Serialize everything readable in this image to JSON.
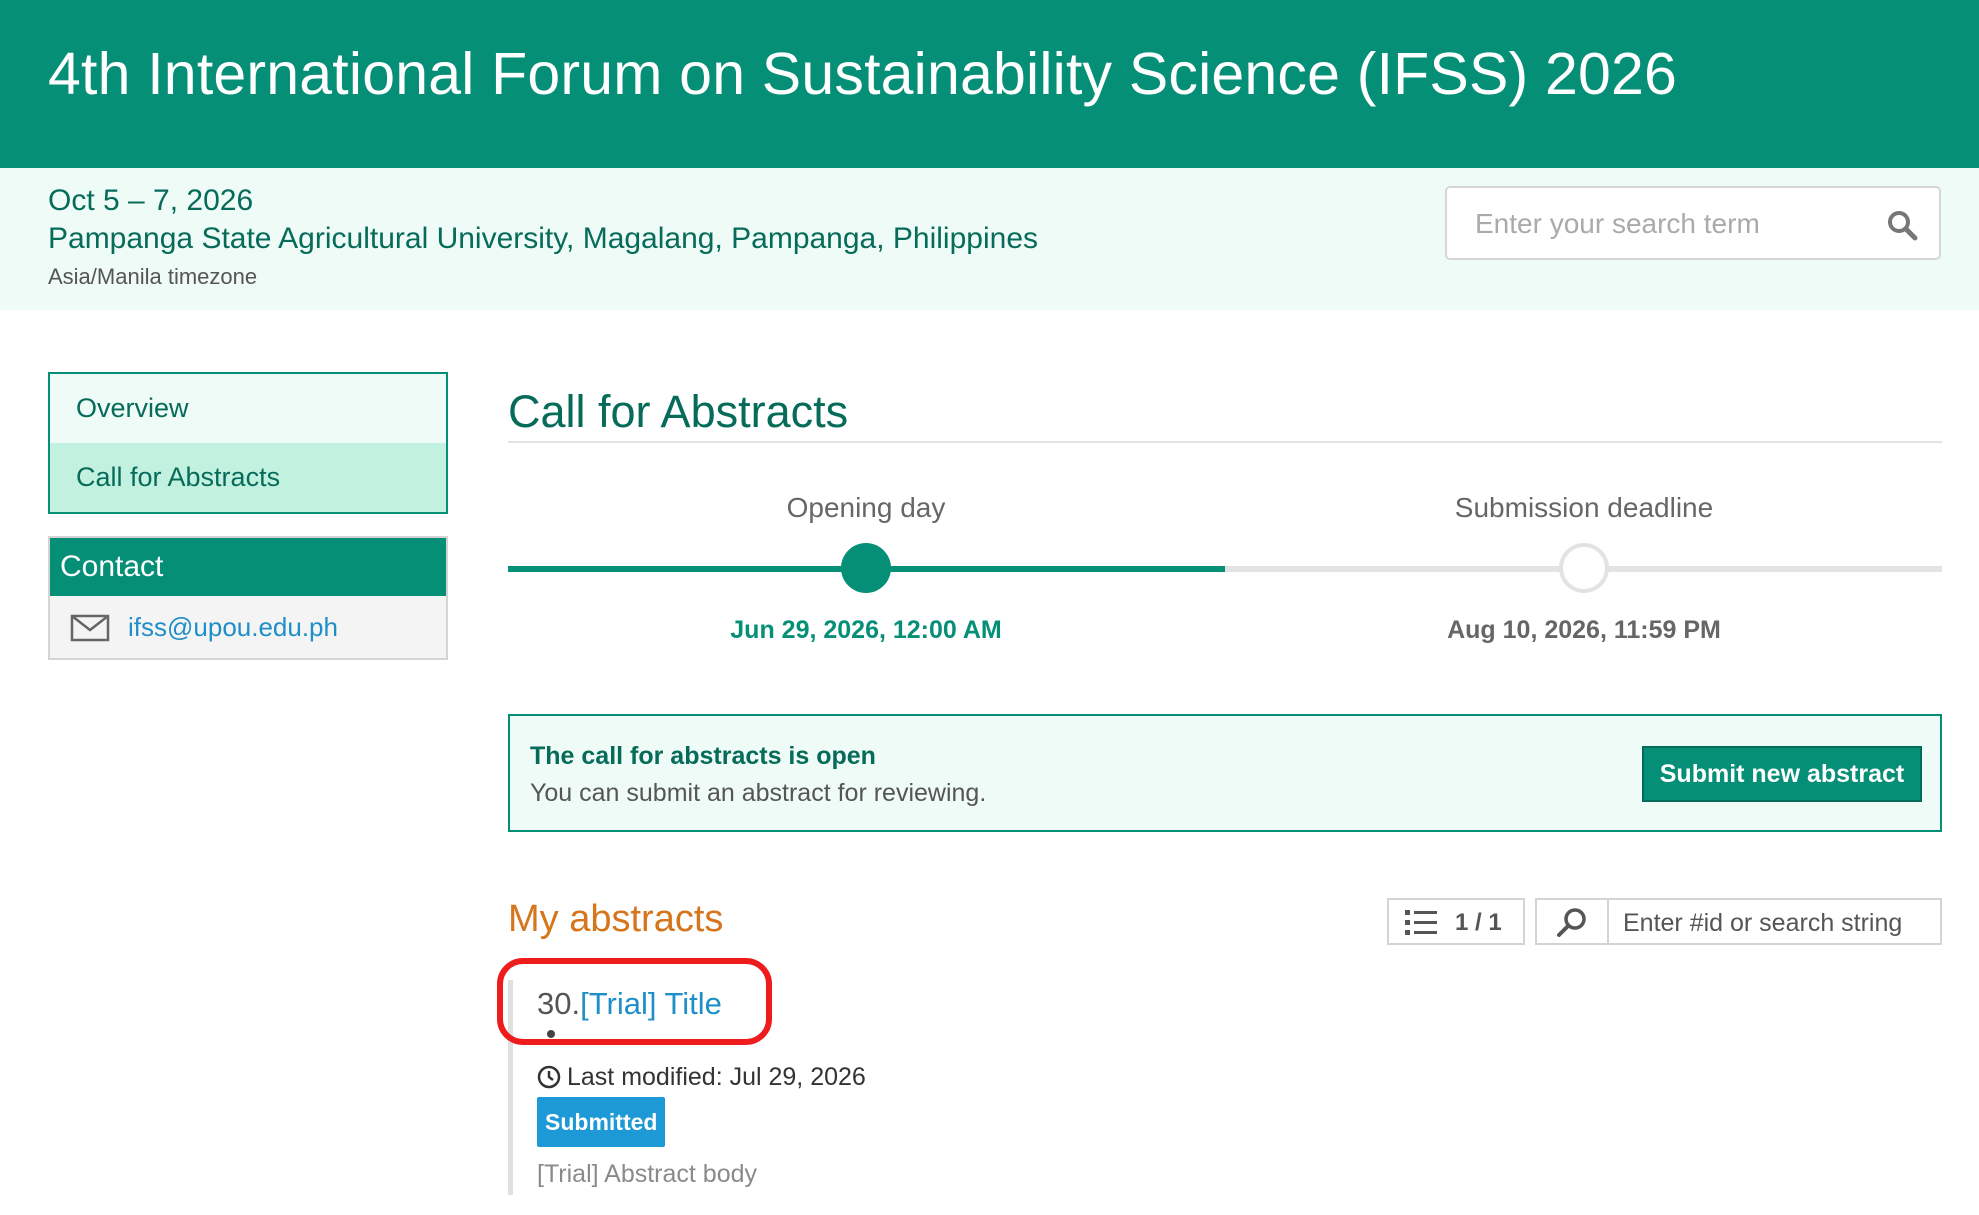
{
  "header": {
    "title": "4th International Forum on Sustainability Science (IFSS) 2026"
  },
  "event": {
    "dates": "Oct 5 – 7, 2026",
    "venue": "Pampanga State Agricultural University, Magalang, Pampanga, Philippines",
    "timezone": "Asia/Manila timezone"
  },
  "search": {
    "placeholder": "Enter your search term",
    "icon": "search-icon"
  },
  "sidebar": {
    "items": [
      {
        "label": "Overview",
        "active": false
      },
      {
        "label": "Call for Abstracts",
        "active": true
      }
    ],
    "contact": {
      "heading": "Contact",
      "email": "ifss@upou.edu.ph",
      "icon": "mail-icon"
    }
  },
  "main": {
    "title": "Call for Abstracts",
    "timeline": {
      "progress_percent": 50,
      "steps": [
        {
          "label": "Opening day",
          "date": "Jun 29, 2026, 12:00 AM",
          "reached": true
        },
        {
          "label": "Submission deadline",
          "date": "Aug 10, 2026, 11:59 PM",
          "reached": false
        }
      ]
    },
    "notice": {
      "title": "The call for abstracts is open",
      "text": "You can submit an abstract for reviewing.",
      "button_label": "Submit new abstract"
    },
    "my_abstracts": {
      "heading": "My abstracts",
      "counter": "1 / 1",
      "search_placeholder": "Enter #id or search string",
      "items": [
        {
          "id": "30.",
          "title": "[Trial] Title",
          "last_modified": "Last modified: Jul 29, 2026",
          "status": "Submitted",
          "body": "[Trial] Abstract body"
        }
      ]
    }
  },
  "colors": {
    "brand": "#068f77",
    "brand_light": "#eefbf7",
    "accent_orange": "#d5751c",
    "link": "#1f8fc8",
    "status_submitted": "#1d9ad6",
    "highlight": "#ee1c1c"
  }
}
